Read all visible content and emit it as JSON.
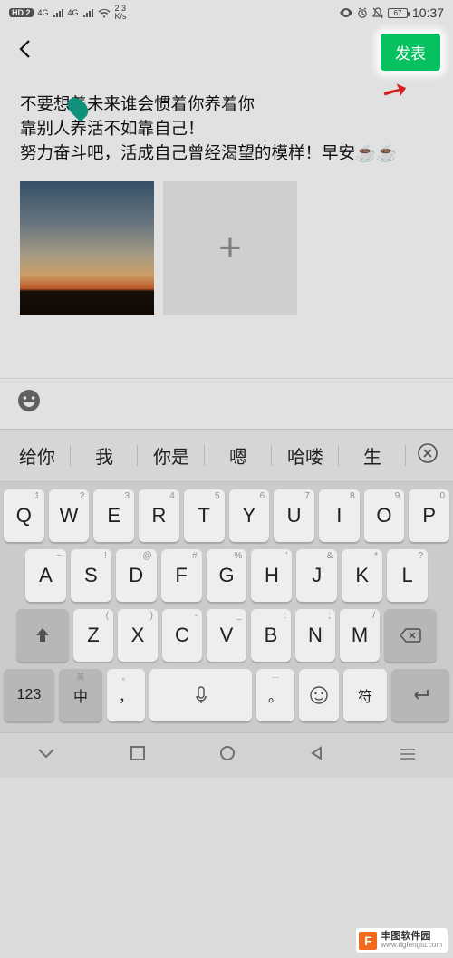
{
  "statusbar": {
    "hd_badge": "HD 2",
    "sig1_label": "4G",
    "sig2_label": "4G",
    "speed": "2.3",
    "speed_unit": "K/s",
    "battery": "67",
    "time": "10:37"
  },
  "header": {
    "publish_label": "发表"
  },
  "post": {
    "text": "不要想着未来谁会惯着你养着你\n靠别人养活不如靠自己！\n努力奋斗吧，活成自己曾经渴望的模样！早安☕☕"
  },
  "add_button": {
    "plus": "+"
  },
  "suggestions": {
    "items": [
      "给你",
      "我",
      "你是",
      "嗯",
      "哈喽",
      "生"
    ]
  },
  "keyboard": {
    "row1": [
      {
        "main": "Q",
        "sup": "1"
      },
      {
        "main": "W",
        "sup": "2"
      },
      {
        "main": "E",
        "sup": "3"
      },
      {
        "main": "R",
        "sup": "4"
      },
      {
        "main": "T",
        "sup": "5"
      },
      {
        "main": "Y",
        "sup": "6"
      },
      {
        "main": "U",
        "sup": "7"
      },
      {
        "main": "I",
        "sup": "8"
      },
      {
        "main": "O",
        "sup": "9"
      },
      {
        "main": "P",
        "sup": "0"
      }
    ],
    "row2": [
      {
        "main": "A",
        "sup": "~"
      },
      {
        "main": "S",
        "sup": "!"
      },
      {
        "main": "D",
        "sup": "@"
      },
      {
        "main": "F",
        "sup": "#"
      },
      {
        "main": "G",
        "sup": "%"
      },
      {
        "main": "H",
        "sup": "'"
      },
      {
        "main": "J",
        "sup": "&"
      },
      {
        "main": "K",
        "sup": "*"
      },
      {
        "main": "L",
        "sup": "?"
      }
    ],
    "row3": [
      {
        "main": "Z",
        "sup": "("
      },
      {
        "main": "X",
        "sup": ")"
      },
      {
        "main": "C",
        "sup": "-"
      },
      {
        "main": "V",
        "sup": "_"
      },
      {
        "main": "B",
        "sup": ":"
      },
      {
        "main": "N",
        "sup": ";"
      },
      {
        "main": "M",
        "sup": "/"
      }
    ],
    "num_label": "123",
    "lang_label": "中",
    "lang_sub": "英",
    "comma": "，",
    "comma_sub": "。",
    "period": "。",
    "period_sub": "...",
    "sym_label": "符",
    "enter_icon": "↵"
  },
  "watermark": {
    "logo": "F",
    "name": "丰图软件园",
    "url": "www.dgfengtu.com"
  }
}
